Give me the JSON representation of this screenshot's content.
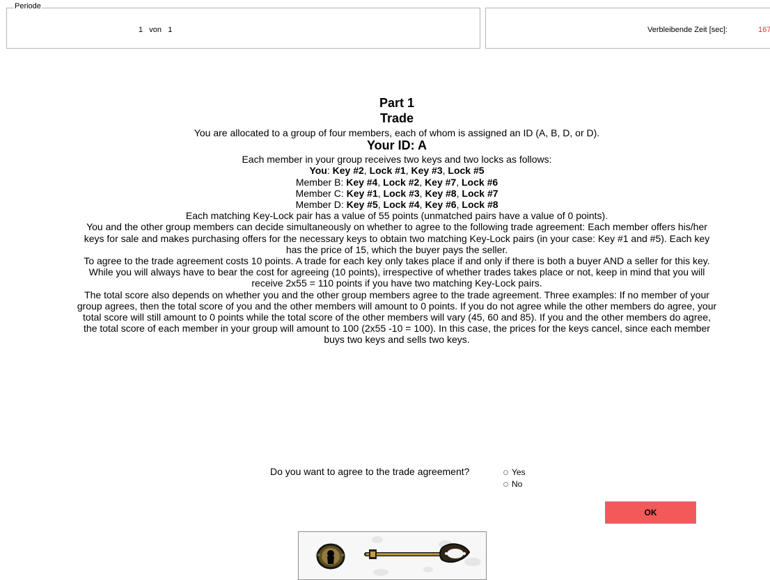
{
  "header": {
    "legend": "Periode",
    "period_current": "1",
    "period_of": "von",
    "period_total": "1",
    "time_label": "Verbleibende Zeit [sec]:",
    "time_value": "167"
  },
  "main": {
    "part_title": "Part 1",
    "trade_title": "Trade",
    "intro": "You are allocated to a group of four members, each of whom is assigned an ID (A, B, D, or D).",
    "your_id": "Your ID: A",
    "keys_intro": "Each member in your group receives two keys and two locks as follows:",
    "allocations": {
      "you": {
        "label": "You",
        "items": [
          "Key #2",
          "Lock #1",
          "Key #3",
          "Lock #5"
        ]
      },
      "b": {
        "label": "Member B:",
        "items": [
          "Key #4",
          "Lock #2",
          "Key #7",
          "Lock #6"
        ]
      },
      "c": {
        "label": "Member C:",
        "items": [
          "Key #1",
          "Lock #3",
          "Key #8",
          "Lock #7"
        ]
      },
      "d": {
        "label": "Member D:",
        "items": [
          "Key #5",
          "Lock #4",
          "Key #6",
          "Lock #8"
        ]
      }
    },
    "paragraphs": [
      "Each matching Key-Lock pair has a value of 55 points (unmatched pairs have a value of 0 points).",
      "You and the other group members can decide simultaneously on whether to agree to the following trade agreement: Each member offers his/her keys for sale and makes purchasing offers for the necessary keys to obtain two matching Key-Lock pairs (in your case: Key #1 and #5). Each key has the price of 15, which the buyer pays the seller.",
      "To agree to the trade agreement costs 10 points. A trade for each key only takes place if and only if there is both a buyer AND a seller for this key. While you will always have to bear the cost for agreeing (10 points), irrespective of whether trades takes place or not, keep in mind that you will receive 2x55 = 110 points if you have two matching Key-Lock pairs.",
      "The total score also depends on whether you and the other group members agree to the trade agreement. Three examples: If no member of your group agrees, then the total score of you and the other members will amount to 0 points. If you do not agree while the other members do agree, your total score will still amount to 0 points while the total score of the other members will vary (45, 60 and 85). If you and the other members do agree, the total score of each member in your group will amount to 100 (2x55 -10 = 100). In this case, the prices for the keys cancel, since each member buys two keys and sells two keys."
    ],
    "question": "Do you want to agree to the trade agreement?",
    "options": [
      "Yes",
      "No"
    ],
    "ok_label": "OK"
  },
  "illustration": {
    "icons": [
      "keyhole-icon",
      "key-icon"
    ]
  }
}
